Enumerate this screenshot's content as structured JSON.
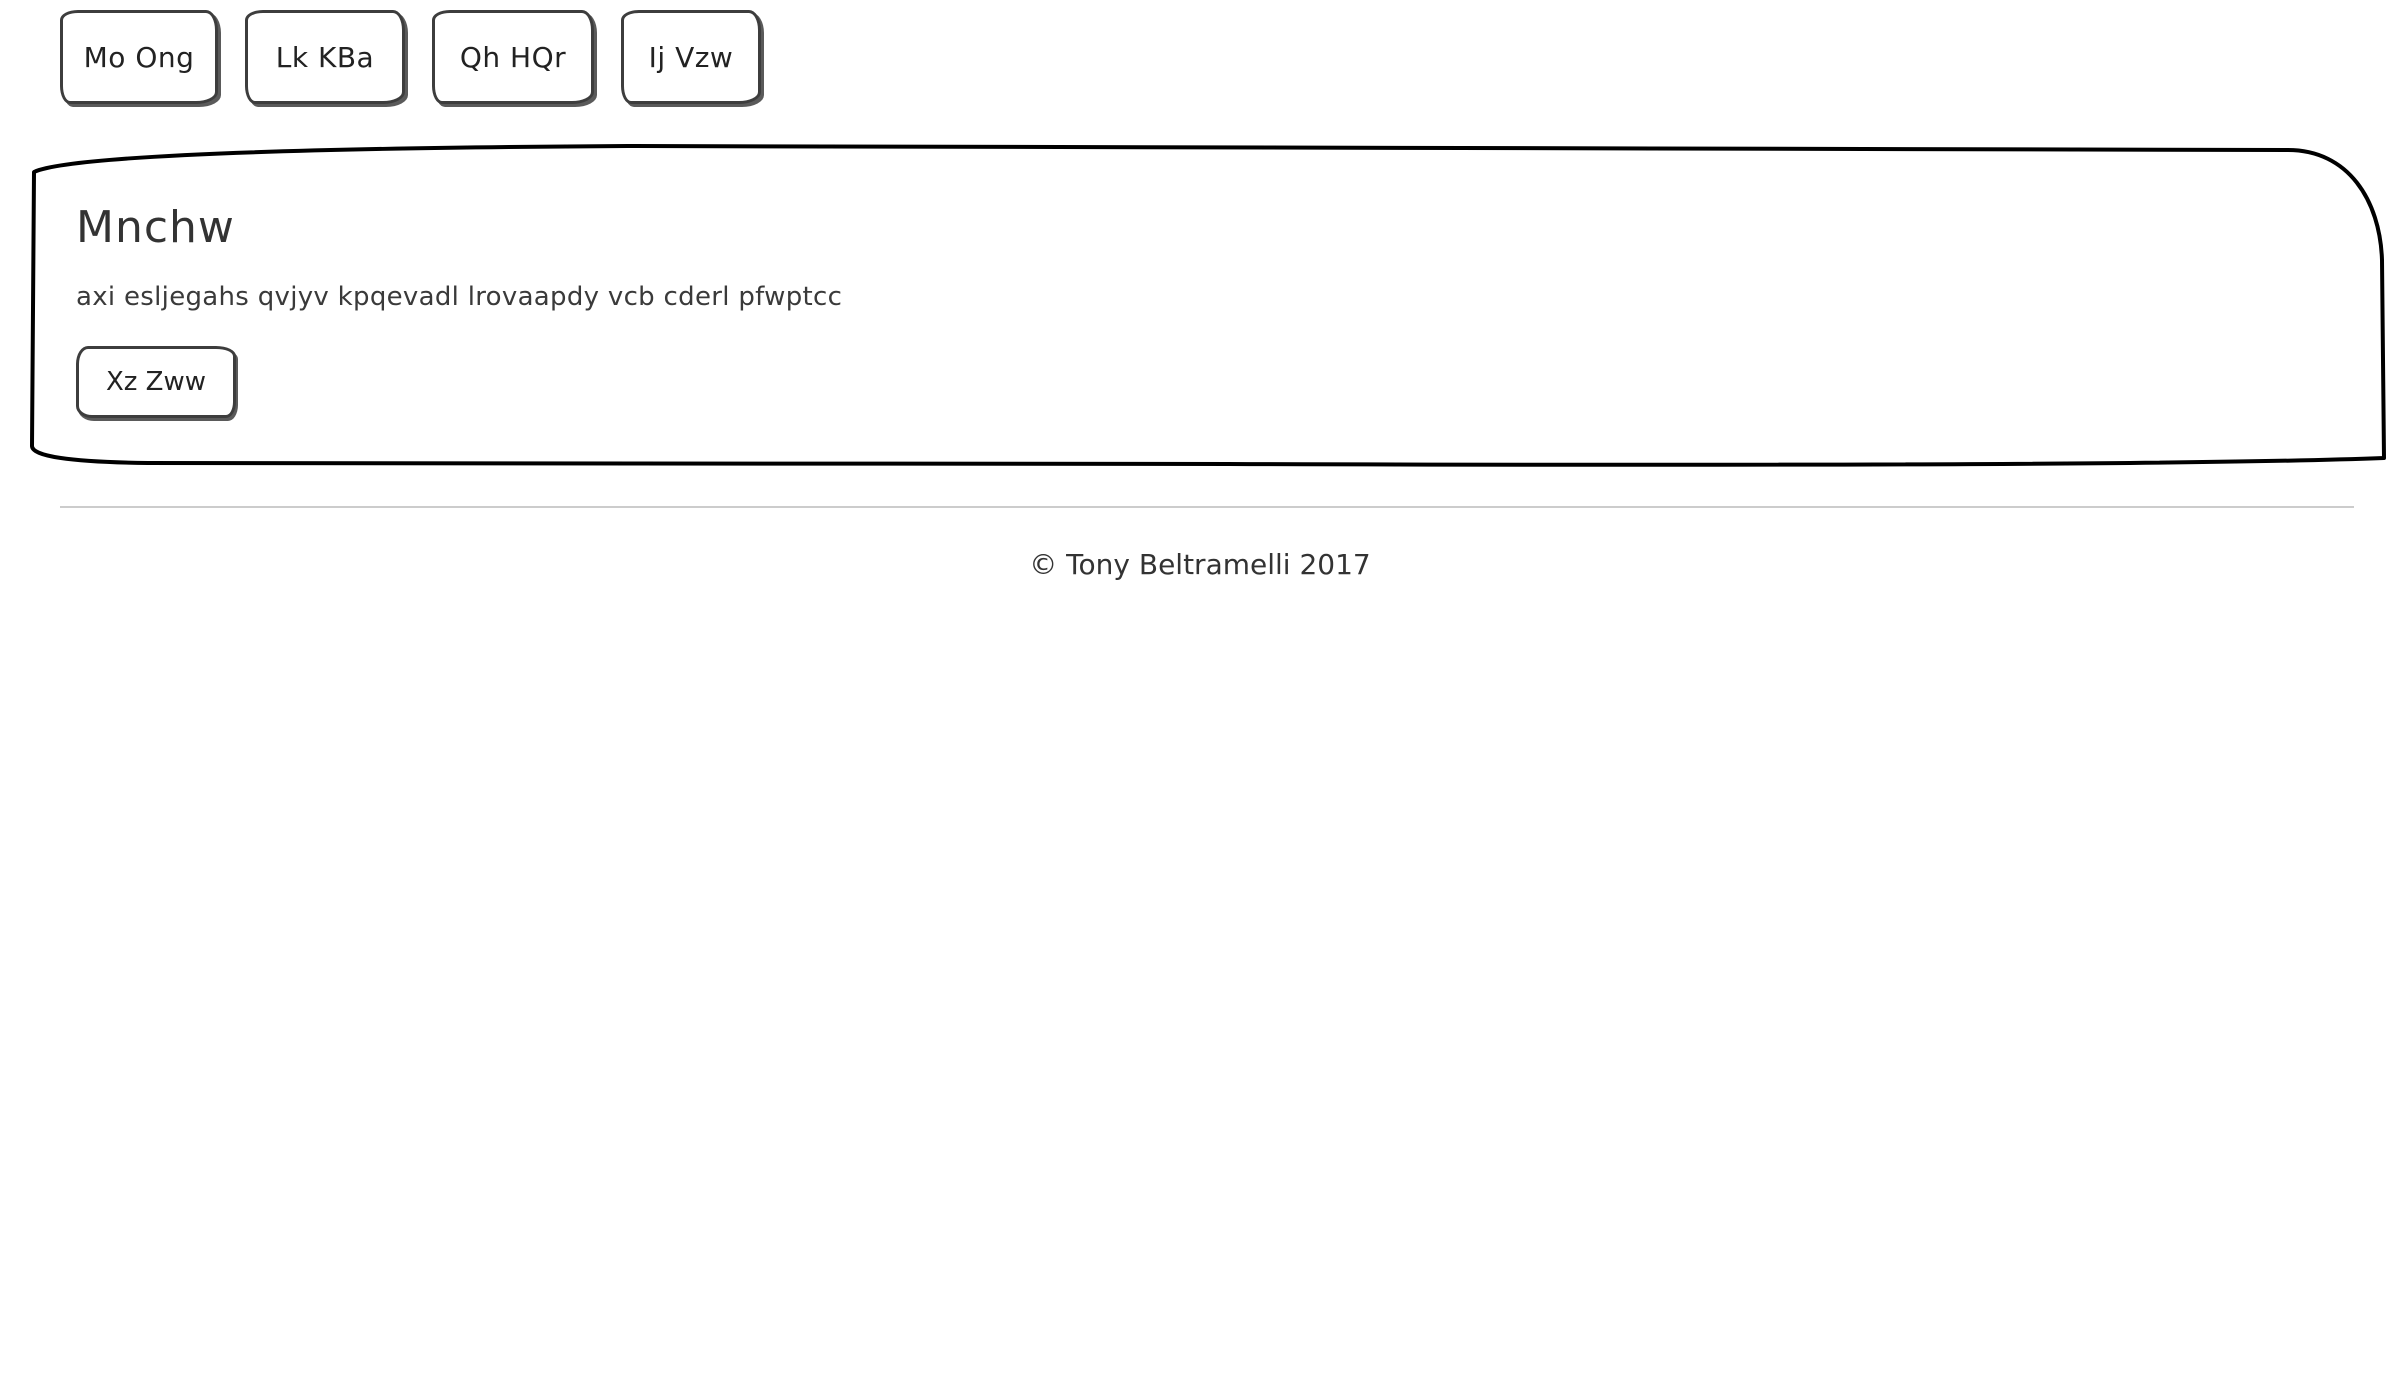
{
  "nav": {
    "buttons": [
      {
        "label": "Mo Ong"
      },
      {
        "label": "Lk KBa"
      },
      {
        "label": "Qh HQr"
      },
      {
        "label": "Ij Vzw"
      }
    ]
  },
  "hero": {
    "title": "Mnchw",
    "text": "axi esljegahs qvjyv kpqevadl lrovaapdy vcb cderl pfwptcc",
    "button_label": "Xz Zww"
  },
  "footer": {
    "text": "© Tony Beltramelli 2017"
  }
}
